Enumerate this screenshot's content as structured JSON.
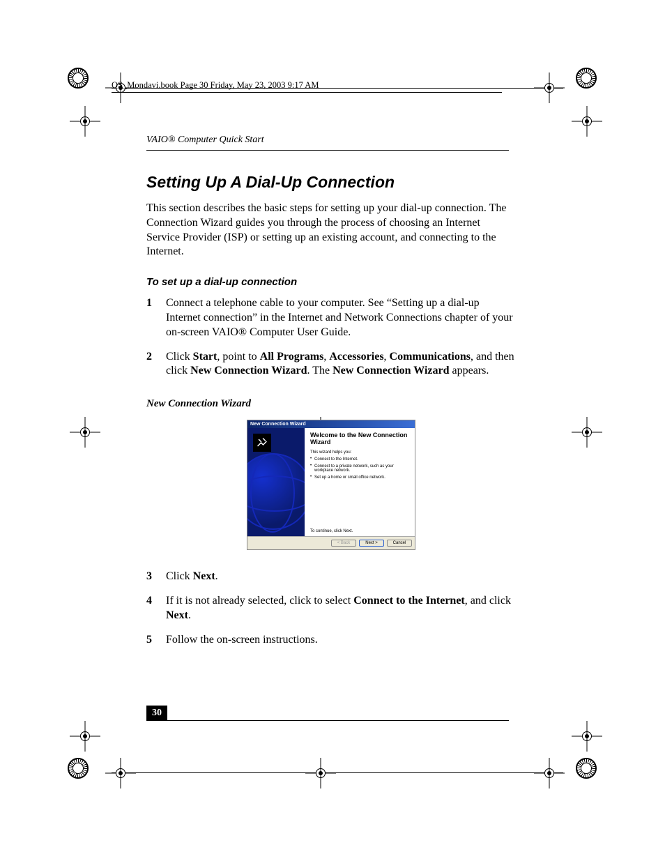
{
  "book_header": "QS_Mondavi.book  Page 30  Friday, May 23, 2003  9:17 AM",
  "running_head": "VAIO® Computer Quick Start",
  "title": "Setting Up A Dial-Up Connection",
  "intro": "This section describes the basic steps for setting up your dial-up connection. The Connection Wizard guides you through the process of choosing an Internet Service Provider (ISP) or setting up an existing account, and connecting to the Internet.",
  "subhead": "To set up a dial-up connection",
  "steps": [
    "Connect a telephone cable to your computer. See “Setting up a dial-up Internet connection” in the Internet and Network Connections chapter of your on-screen VAIO® Computer User Guide.",
    "Click <b>Start</b>, point to <b>All Programs</b>, <b>Accessories</b>, <b>Communications</b>, and then click <b>New Connection Wizard</b>. The <b>New Connection Wizard</b> appears.",
    "Click <b>Next</b>.",
    "If it is not already selected, click to select <b>Connect to the Internet</b>, and click <b>Next</b>.",
    "Follow the on-screen instructions."
  ],
  "figure_caption": "New Connection Wizard",
  "wizard": {
    "titlebar": "New Connection Wizard",
    "heading": "Welcome to the New Connection Wizard",
    "help": "This wizard helps you:",
    "bullets": [
      "Connect to the Internet.",
      "Connect to a private network, such as your workplace network.",
      "Set up a home or small office network."
    ],
    "continue": "To continue, click Next.",
    "buttons": {
      "back": "< Back",
      "next": "Next >",
      "cancel": "Cancel"
    }
  },
  "page_number": "30"
}
